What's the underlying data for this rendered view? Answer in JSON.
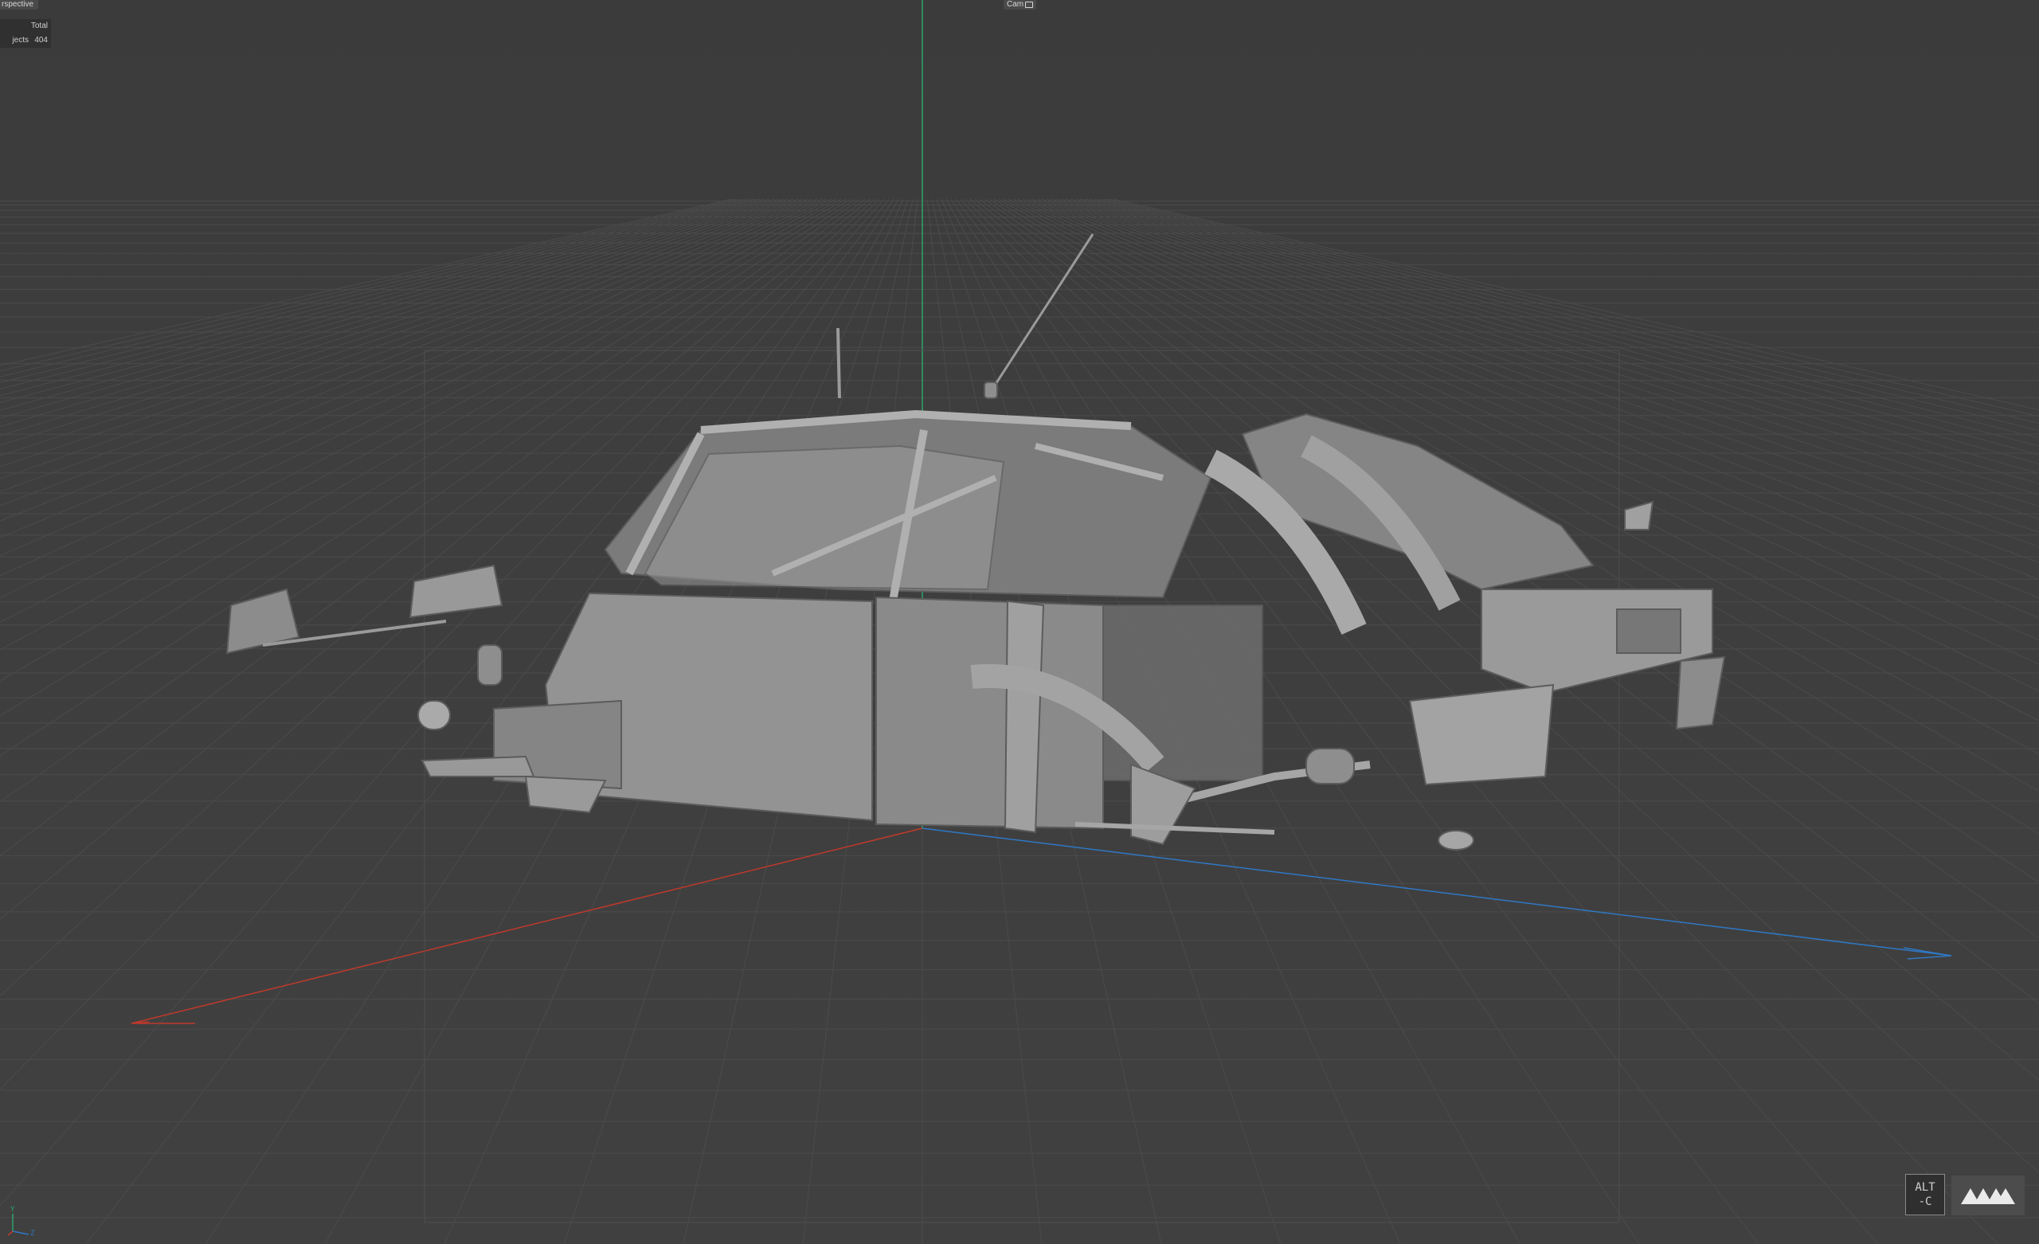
{
  "viewport": {
    "mode_label": "rspective",
    "camera_label": "Cam",
    "hud": {
      "header": "Total",
      "rows": [
        {
          "label": "jects",
          "value": "404"
        }
      ]
    },
    "axis_letters": {
      "y": "Y",
      "z": "Z"
    },
    "shortcut": {
      "line1": "ALT",
      "line2": "-C"
    },
    "logo_icon": "maxon-logo-icon",
    "colors": {
      "background": "#3d3d3d",
      "grid": "#4a4a4a",
      "x_axis": "#c0392b",
      "y_axis": "#2ea36b",
      "z_axis": "#2f78c4",
      "model": "#8f8f8f"
    }
  }
}
